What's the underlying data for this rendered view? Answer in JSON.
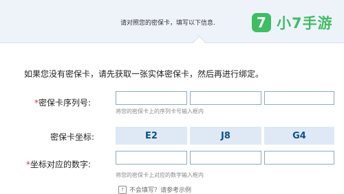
{
  "header": {
    "notice": "请对照您的密保卡，填写以下信息.",
    "logo_glyph": "7",
    "logo_text": "小7手游",
    "logo_icon": "7-logo-icon",
    "logo_color": "#3fbd63"
  },
  "intro": "如果您没有密保卡，请先获取一张实体密保卡，然后再进行绑定。",
  "serial": {
    "required_mark": "*",
    "label": "密保卡序列号:",
    "hint": "将您的密保卡上的序列卡号输入框内"
  },
  "coordinates": {
    "label": "密保卡坐标:",
    "values": [
      "E2",
      "J8",
      "G4"
    ],
    "cell_color": "#dfe9f5"
  },
  "digits": {
    "required_mark": "*",
    "label": "坐标对应的数字:",
    "hint": "将您的密保卡上对应的数字输入框内"
  },
  "help": {
    "icon": "help-icon",
    "text": "不会填写？请参考示例"
  }
}
